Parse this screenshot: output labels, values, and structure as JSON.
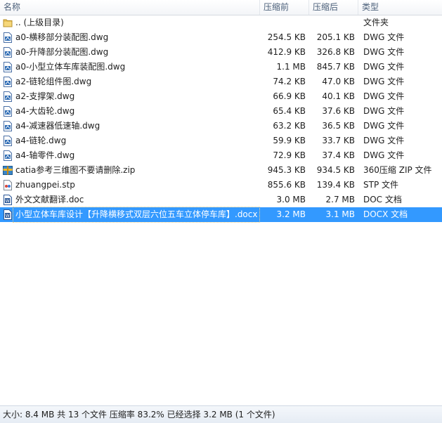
{
  "columns": {
    "name": "名称",
    "before": "压缩前",
    "after": "压缩后",
    "type": "类型"
  },
  "files": [
    {
      "name": ".. (上级目录)",
      "before": "",
      "after": "",
      "type": "文件夹",
      "icon": "folder-icon"
    },
    {
      "name": "a0-横移部分装配图.dwg",
      "before": "254.5 KB",
      "after": "205.1 KB",
      "type": "DWG 文件",
      "icon": "dwg-file-icon"
    },
    {
      "name": "a0-升降部分装配图.dwg",
      "before": "412.9 KB",
      "after": "326.8 KB",
      "type": "DWG 文件",
      "icon": "dwg-file-icon"
    },
    {
      "name": "a0-小型立体车库装配图.dwg",
      "before": "1.1 MB",
      "after": "845.7 KB",
      "type": "DWG 文件",
      "icon": "dwg-file-icon"
    },
    {
      "name": "a2-链轮组件图.dwg",
      "before": "74.2 KB",
      "after": "47.0 KB",
      "type": "DWG 文件",
      "icon": "dwg-file-icon"
    },
    {
      "name": "a2-支撑架.dwg",
      "before": "66.9 KB",
      "after": "40.1 KB",
      "type": "DWG 文件",
      "icon": "dwg-file-icon"
    },
    {
      "name": "a4-大齿轮.dwg",
      "before": "65.4 KB",
      "after": "37.6 KB",
      "type": "DWG 文件",
      "icon": "dwg-file-icon"
    },
    {
      "name": "a4-减速器低速轴.dwg",
      "before": "63.2 KB",
      "after": "36.5 KB",
      "type": "DWG 文件",
      "icon": "dwg-file-icon"
    },
    {
      "name": "a4-链轮.dwg",
      "before": "59.9 KB",
      "after": "33.7 KB",
      "type": "DWG 文件",
      "icon": "dwg-file-icon"
    },
    {
      "name": "a4-轴零件.dwg",
      "before": "72.9 KB",
      "after": "37.4 KB",
      "type": "DWG 文件",
      "icon": "dwg-file-icon"
    },
    {
      "name": "catia参考三维图不要请删除.zip",
      "before": "945.3 KB",
      "after": "934.5 KB",
      "type": "360压缩 ZIP 文件",
      "icon": "zip-archive-icon"
    },
    {
      "name": "zhuangpei.stp",
      "before": "855.6 KB",
      "after": "139.4 KB",
      "type": "STP 文件",
      "icon": "stp-file-icon"
    },
    {
      "name": "外文文献翻译.doc",
      "before": "3.0 MB",
      "after": "2.7 MB",
      "type": "DOC 文档",
      "icon": "word-doc-icon"
    },
    {
      "name": "小型立体车库设计【升降横移式双层六位五车立体停车库】.docx",
      "before": "3.2 MB",
      "after": "3.1 MB",
      "type": "DOCX 文档",
      "icon": "word-doc-icon",
      "selected": true
    }
  ],
  "status": {
    "text": "大小: 8.4 MB 共 13 个文件 压缩率 83.2% 已经选择 3.2 MB (1 个文件)"
  }
}
